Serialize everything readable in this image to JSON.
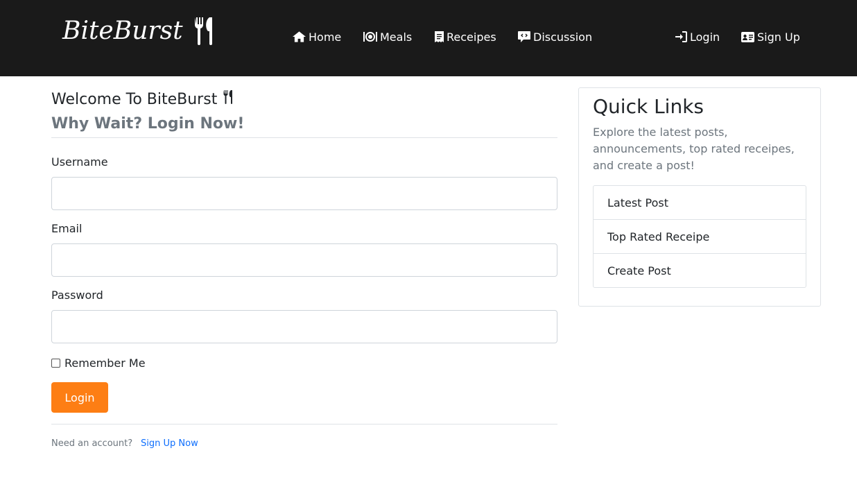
{
  "nav": {
    "brand": "BiteBurst",
    "items": [
      {
        "label": "Home",
        "icon": "home-icon"
      },
      {
        "label": "Meals",
        "icon": "plate-icon"
      },
      {
        "label": "Receipes",
        "icon": "receipt-icon"
      },
      {
        "label": "Discussion",
        "icon": "comment-icon"
      },
      {
        "label": "Login",
        "icon": "login-icon"
      },
      {
        "label": "Sign Up",
        "icon": "id-card-icon"
      }
    ]
  },
  "main": {
    "welcome": "Welcome To BiteBurst",
    "subheading": "Why Wait? Login Now!",
    "username_label": "Username",
    "email_label": "Email",
    "password_label": "Password",
    "remember_label": "Remember Me",
    "login_button": "Login",
    "need_account": "Need an account?",
    "signup_link": "Sign Up Now"
  },
  "sidebar": {
    "title": "Quick Links",
    "text": "Explore the latest posts, announcements, top rated receipes, and create a post!",
    "links": [
      "Latest Post",
      "Top Rated Receipe",
      "Create Post"
    ]
  },
  "colors": {
    "navbar": "#1a1a1a",
    "accent": "#fd7e14",
    "link": "#0d6efd",
    "muted": "#6c757d"
  }
}
